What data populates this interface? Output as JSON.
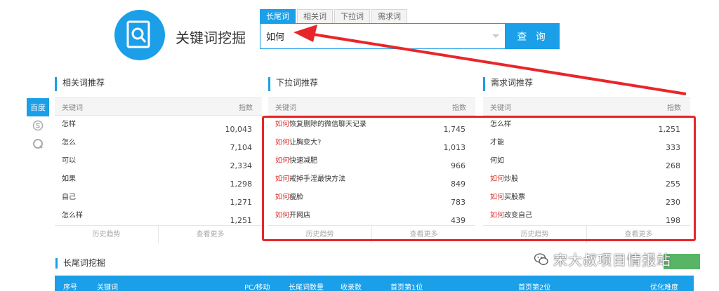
{
  "app": {
    "title": "关键词挖掘",
    "logo_icon": "document-search-icon"
  },
  "search": {
    "tabs": [
      "长尾词",
      "相关词",
      "下拉词",
      "需求词"
    ],
    "active_tab": 0,
    "value": "如何",
    "button_label": "查 询"
  },
  "engines": {
    "items": [
      {
        "label": "百度",
        "icon": "baidu-icon"
      },
      {
        "label": "",
        "icon": "sogou-icon"
      },
      {
        "label": "",
        "icon": "360-icon"
      }
    ],
    "active": 0
  },
  "panels": [
    {
      "title": "相关词推荐",
      "col_keyword": "关键词",
      "col_index": "指数",
      "rows": [
        {
          "prefix": "",
          "keyword": "怎样",
          "index": "10,043"
        },
        {
          "prefix": "",
          "keyword": "怎么",
          "index": "7,104"
        },
        {
          "prefix": "",
          "keyword": "可以",
          "index": "2,334"
        },
        {
          "prefix": "",
          "keyword": "如果",
          "index": "1,298"
        },
        {
          "prefix": "",
          "keyword": "自己",
          "index": "1,271"
        },
        {
          "prefix": "",
          "keyword": "怎么样",
          "index": "1,251"
        }
      ],
      "foot": [
        "历史趋势",
        "查看更多"
      ]
    },
    {
      "title": "下拉词推荐",
      "col_keyword": "关键词",
      "col_index": "指数",
      "rows": [
        {
          "prefix": "如何",
          "keyword": "恢复删除的微信聊天记录",
          "index": "1,745"
        },
        {
          "prefix": "如何",
          "keyword": "让胸变大?",
          "index": "1,013"
        },
        {
          "prefix": "如何",
          "keyword": "快速减肥",
          "index": "966"
        },
        {
          "prefix": "如何",
          "keyword": "戒掉手淫最快方法",
          "index": "849"
        },
        {
          "prefix": "如何",
          "keyword": "瘦脸",
          "index": "783"
        },
        {
          "prefix": "如何",
          "keyword": "开网店",
          "index": "439"
        }
      ],
      "foot": [
        "历史趋势",
        "查看更多"
      ]
    },
    {
      "title": "需求词推荐",
      "col_keyword": "关键词",
      "col_index": "指数",
      "rows": [
        {
          "prefix": "",
          "keyword": "怎么样",
          "index": "1,251"
        },
        {
          "prefix": "",
          "keyword": "才能",
          "index": "333"
        },
        {
          "prefix": "",
          "keyword": "何如",
          "index": "268"
        },
        {
          "prefix": "如何",
          "keyword": "炒股",
          "index": "255"
        },
        {
          "prefix": "如何",
          "keyword": "买股票",
          "index": "230"
        },
        {
          "prefix": "如何",
          "keyword": "改变自己",
          "index": "198"
        }
      ],
      "foot": [
        "历史趋势",
        "查看更多"
      ]
    }
  ],
  "long_tail": {
    "title": "长尾词挖掘",
    "columns": [
      "序号",
      "关键词",
      "PC/移动",
      "长尾词数量",
      "收录数",
      "首页第1位",
      "首页第2位",
      "优化难度"
    ]
  },
  "watermark": {
    "text": "宋大叔项目情报站",
    "icon": "wechat-icon"
  },
  "colors": {
    "accent": "#1a9fe8",
    "highlight": "#e03030",
    "annotation": "#e8262a"
  }
}
